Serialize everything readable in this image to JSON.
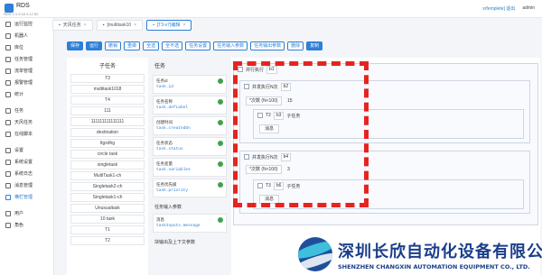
{
  "header": {
    "brand": "RDS",
    "version": "RDS 1.1.9.16 4.17.52",
    "user_link": "srfemplete] 退出",
    "user_name": "admin"
  },
  "tabs": [
    {
      "label": "天风任务",
      "icon": "home-icon"
    },
    {
      "label": "[multitask10",
      "icon": "doc-icon"
    },
    {
      "label": "[T3-v7]编辑",
      "icon": "doc-icon"
    }
  ],
  "sidebar": {
    "items": [
      {
        "label": "运行监控",
        "icon": "monitor-icon"
      },
      {
        "label": "机器人",
        "icon": "robot-icon"
      },
      {
        "label": "库位",
        "icon": "location-icon"
      },
      {
        "label": "任务管理",
        "icon": "task-icon"
      },
      {
        "label": "流单管理",
        "icon": "flow-icon"
      },
      {
        "label": "报警管理",
        "icon": "alarm-icon"
      },
      {
        "label": "统计",
        "icon": "stats-icon"
      },
      {
        "label": "任务",
        "icon": "task-icon"
      },
      {
        "label": "天风任务",
        "icon": "task-icon"
      },
      {
        "label": "在线脚本",
        "icon": "script-icon"
      },
      {
        "label": "设置",
        "icon": "settings-icon"
      },
      {
        "label": "系统设置",
        "icon": "settings-icon"
      },
      {
        "label": "系统日志",
        "icon": "log-icon"
      },
      {
        "label": "消息管理",
        "icon": "message-icon"
      },
      {
        "label": "横栏管理",
        "icon": "panel-icon"
      },
      {
        "label": "用户",
        "icon": "user-icon"
      },
      {
        "label": "角色",
        "icon": "role-icon"
      }
    ],
    "active_index": 14
  },
  "toolbar": [
    "保存",
    "运行",
    "撤销",
    "重做",
    "全选",
    "全不选",
    "任务设置",
    "任务输入参数",
    "任务输出参数",
    "删除",
    "复制"
  ],
  "subtasks": {
    "title": "子任务",
    "items": [
      "T3",
      "multitask1018",
      "T4",
      "111",
      "111111111111111",
      "destination",
      "ltgxdhg",
      "circle task",
      "singletask",
      "MultiTask1-ch",
      "Singletask2-ch",
      "Singletask1-ch",
      "Unusualtask",
      "10 task",
      "T1",
      "T2"
    ]
  },
  "props": {
    "title": "任务",
    "items": [
      {
        "name": "任务id",
        "code": "task.id"
      },
      {
        "name": "任务名称",
        "code": "task.defLabel"
      },
      {
        "name": "创建时间",
        "code": "task.createdOn"
      },
      {
        "name": "任务状态",
        "code": "task.status"
      },
      {
        "name": "任务变量",
        "code": "task.variables"
      },
      {
        "name": "任务优先级",
        "code": "task.priority"
      }
    ],
    "input_title": "任务输入参数",
    "input_item": {
      "name": "消息",
      "code": "taskInputs.message"
    },
    "output_title": "块输出及上下文参数"
  },
  "canvas": {
    "outer": {
      "label": "并行执行",
      "badge": "b1"
    },
    "group1": {
      "label": "并发执行N次",
      "badge": "b2",
      "field": "*次数 (N<100)",
      "value": "15",
      "task": "T2",
      "task_badge": "b3",
      "task_label": "子任务",
      "msg": "消息"
    },
    "group2": {
      "label": "并发执行N次",
      "badge": "b4",
      "field": "*次数 (N<100)",
      "value": "3",
      "task": "T3",
      "task_badge": "b6",
      "task_label": "子任务",
      "msg": "消息"
    }
  },
  "footer": {
    "company_cn": "深圳长欣自动化设备有限公司",
    "company_en": "SHENZHEN CHANGXIN AUTOMATION EQUIPMENT CO., LTD."
  },
  "colors": {
    "accent": "#2f7fd6",
    "highlight": "#e52420",
    "brand": "#1b3e8a"
  }
}
